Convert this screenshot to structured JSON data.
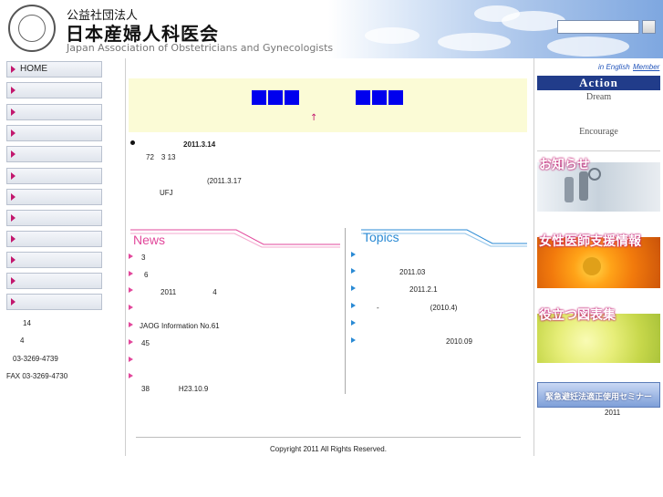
{
  "header": {
    "org_type": "公益社団法人",
    "org_name": "日本産婦人科医会",
    "org_english": "Japan Association of Obstetricians and Gynecologists",
    "search_placeholder": ""
  },
  "sidebar": {
    "items": [
      {
        "label": "HOME"
      },
      {
        "label": ""
      },
      {
        "label": ""
      },
      {
        "label": ""
      },
      {
        "label": ""
      },
      {
        "label": ""
      },
      {
        "label": ""
      },
      {
        "label": ""
      },
      {
        "label": ""
      },
      {
        "label": ""
      },
      {
        "label": ""
      },
      {
        "label": ""
      }
    ],
    "info_lines": [
      "14",
      "4",
      "03-3269-4739",
      "FAX 03-3269-4730"
    ]
  },
  "main": {
    "banner_arrow": "↑",
    "notice": {
      "date": "2011.3.14",
      "line1": "72　3 13",
      "line2": "(2011.3.17",
      "line3": "UFJ"
    },
    "news": {
      "title": "News",
      "items": [
        "3",
        "6",
        "2011　　　　　4",
        "",
        "JAOG Information No.61",
        "45",
        "",
        "",
        "38　　　　H23.10.9"
      ]
    },
    "topics": {
      "title": "Topics",
      "items": [
        "",
        "2011.03",
        "2011.2.1",
        "-　　　　　　　(2010.4)",
        "",
        "2010.09"
      ]
    }
  },
  "right": {
    "in_english": "in English",
    "member": "Member",
    "action": "Action",
    "dream": "Dream",
    "encourage": "Encourage",
    "box1_title": "お知らせ",
    "box2_title": "女性医師支援情報",
    "box3_title": "役立つ図表集",
    "seminar": "緊急避妊法適正使用セミナー",
    "seminar_year": "2011"
  },
  "footer": {
    "copyright": "Copyright 2011 All Rights Reserved."
  },
  "colors": {
    "accent_pink": "#e2479b",
    "accent_blue": "#2a8ad4",
    "action_navy": "#213c8a",
    "banner_yellow": "#fbfbd6",
    "square_blue": "#0000ee"
  }
}
